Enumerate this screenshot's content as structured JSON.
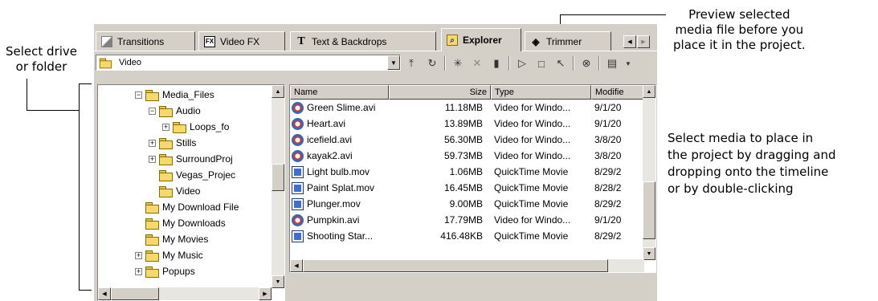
{
  "annotations": {
    "select_drive": "Select drive\nor folder",
    "preview": "Preview selected\nmedia file before you\nplace it in the project.",
    "select_media": "Select media to place in\nthe project by dragging and\ndropping onto the timeline\nor by double-clicking"
  },
  "tabs": [
    {
      "label": "Transitions",
      "icon": "transitions-icon"
    },
    {
      "label": "Video FX",
      "icon": "fx-icon",
      "glyph": "FX"
    },
    {
      "label": "Text & Backdrops",
      "icon": "text-icon",
      "glyph": "T"
    },
    {
      "label": "Explorer",
      "icon": "explorer-icon",
      "active": true
    },
    {
      "label": "Trimmer",
      "icon": "trimmer-icon"
    }
  ],
  "path": {
    "value": "Video"
  },
  "toolbar": [
    "up-folder-icon",
    "refresh-icon",
    "new-folder-icon",
    "delete-icon",
    "favorites-icon",
    "play-icon",
    "stop-icon",
    "auto-preview-icon",
    "search-icon",
    "views-icon"
  ],
  "tree": [
    {
      "label": "Media_Files",
      "depth": 3,
      "exp": "−"
    },
    {
      "label": "Audio",
      "depth": 4,
      "exp": "−"
    },
    {
      "label": "Loops_fo",
      "depth": 5,
      "exp": "+"
    },
    {
      "label": "Stills",
      "depth": 4,
      "exp": "+"
    },
    {
      "label": "SurroundProj",
      "depth": 4,
      "exp": "+"
    },
    {
      "label": "Vegas_Projec",
      "depth": 4,
      "exp": ""
    },
    {
      "label": "Video",
      "depth": 4,
      "exp": "",
      "open": true
    },
    {
      "label": "My Download File",
      "depth": 3,
      "exp": ""
    },
    {
      "label": "My Downloads",
      "depth": 3,
      "exp": ""
    },
    {
      "label": "My Movies",
      "depth": 3,
      "exp": ""
    },
    {
      "label": "My Music",
      "depth": 3,
      "exp": "+"
    },
    {
      "label": "Popups",
      "depth": 3,
      "exp": "+"
    }
  ],
  "columns": [
    {
      "label": "Name"
    },
    {
      "label": "Size"
    },
    {
      "label": "Type"
    },
    {
      "label": "Modifie"
    }
  ],
  "files": [
    {
      "name": "Green Slime.avi",
      "size": "11.18MB",
      "type": "Video for Windo...",
      "modified": "9/1/20",
      "kind": "avi"
    },
    {
      "name": "Heart.avi",
      "size": "13.89MB",
      "type": "Video for Windo...",
      "modified": "9/1/20",
      "kind": "avi"
    },
    {
      "name": "icefield.avi",
      "size": "56.30MB",
      "type": "Video for Windo...",
      "modified": "3/8/20",
      "kind": "avi"
    },
    {
      "name": "kayak2.avi",
      "size": "59.73MB",
      "type": "Video for Windo...",
      "modified": "3/8/20",
      "kind": "avi"
    },
    {
      "name": "Light bulb.mov",
      "size": "1.06MB",
      "type": "QuickTime Movie",
      "modified": "8/29/2",
      "kind": "mov"
    },
    {
      "name": "Paint Splat.mov",
      "size": "16.45MB",
      "type": "QuickTime Movie",
      "modified": "8/28/2",
      "kind": "mov"
    },
    {
      "name": "Plunger.mov",
      "size": "9.00MB",
      "type": "QuickTime Movie",
      "modified": "8/29/2",
      "kind": "mov"
    },
    {
      "name": "Pumpkin.avi",
      "size": "17.79MB",
      "type": "Video for Windo...",
      "modified": "9/1/20",
      "kind": "avi"
    },
    {
      "name": "Shooting Star...",
      "size": "416.48KB",
      "type": "QuickTime Movie",
      "modified": "8/29/2",
      "kind": "mov"
    }
  ]
}
